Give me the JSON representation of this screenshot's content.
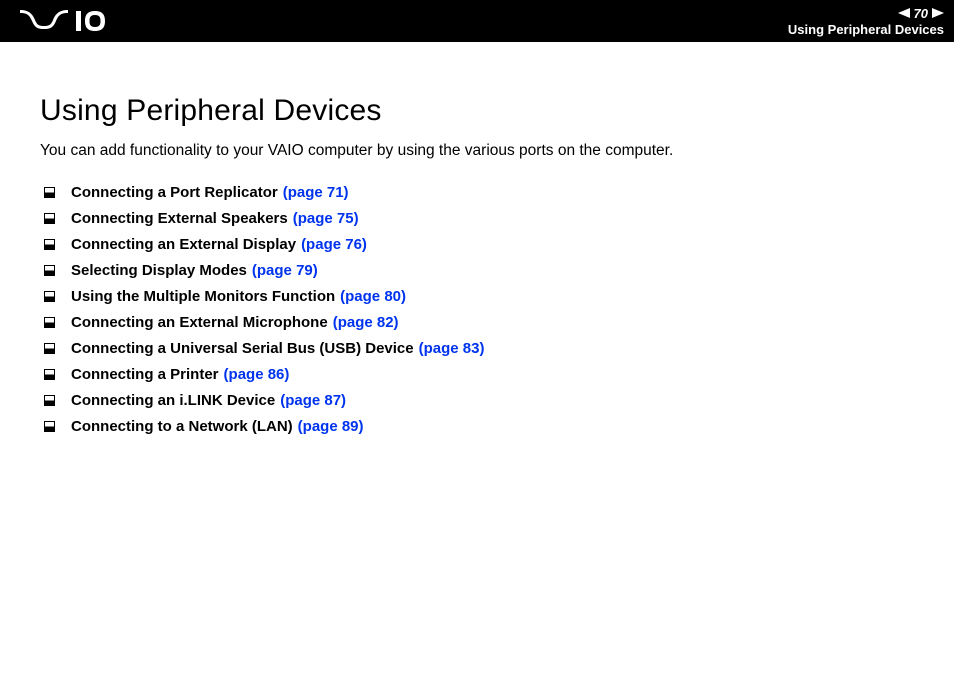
{
  "header": {
    "logo_alt": "VAIO",
    "page_number": "70",
    "section": "Using Peripheral Devices"
  },
  "content": {
    "title": "Using Peripheral Devices",
    "intro": "You can add functionality to your VAIO computer by using the various ports on the computer.",
    "toc": [
      {
        "label": "Connecting a Port Replicator",
        "page_ref": "(page 71)"
      },
      {
        "label": "Connecting External Speakers",
        "page_ref": "(page 75)"
      },
      {
        "label": "Connecting an External Display",
        "page_ref": "(page 76)"
      },
      {
        "label": "Selecting Display Modes",
        "page_ref": "(page 79)"
      },
      {
        "label": "Using the Multiple Monitors Function",
        "page_ref": "(page 80)"
      },
      {
        "label": "Connecting an External Microphone",
        "page_ref": "(page 82)"
      },
      {
        "label": "Connecting a Universal Serial Bus (USB) Device",
        "page_ref": "(page 83)"
      },
      {
        "label": "Connecting a Printer",
        "page_ref": "(page 86)"
      },
      {
        "label": "Connecting an i.LINK Device",
        "page_ref": "(page 87)"
      },
      {
        "label": "Connecting to a Network (LAN)",
        "page_ref": "(page 89)"
      }
    ]
  }
}
